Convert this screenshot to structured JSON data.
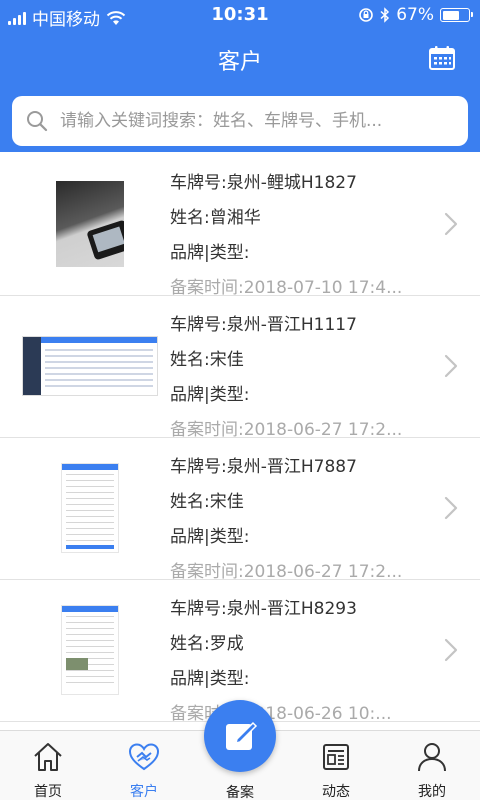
{
  "status_bar": {
    "carrier": "中国移动",
    "time": "10:31",
    "battery": "67%",
    "battery_level": 0.67,
    "icons": [
      "signal-icon",
      "wifi-icon",
      "orientation-lock-icon",
      "bluetooth-icon",
      "battery-icon"
    ]
  },
  "nav": {
    "title": "客户",
    "right_icon": "calendar-icon"
  },
  "search": {
    "placeholder": "请输入关键词搜索：姓名、车牌号、手机...",
    "value": ""
  },
  "customers": [
    {
      "plate": "车牌号:泉州-鲤城H1827",
      "name": "姓名:曾湘华",
      "brand_type": "品牌|类型:",
      "filed_time": "备案时间:2018-07-10 17:4...",
      "thumb": "photo"
    },
    {
      "plate": "车牌号:泉州-晋江H1117",
      "name": "姓名:宋佳",
      "brand_type": "品牌|类型:",
      "filed_time": "备案时间:2018-06-27 17:2...",
      "thumb": "screen"
    },
    {
      "plate": "车牌号:泉州-晋江H7887",
      "name": "姓名:宋佳",
      "brand_type": "品牌|类型:",
      "filed_time": "备案时间:2018-06-27 17:2...",
      "thumb": "doc"
    },
    {
      "plate": "车牌号:泉州-晋江H8293",
      "name": "姓名:罗成",
      "brand_type": "品牌|类型:",
      "filed_time": "备案时间:2018-06-26 10:...",
      "thumb": "doc-pic"
    }
  ],
  "tabbar": {
    "tabs": [
      {
        "label": "首页",
        "icon": "home-icon"
      },
      {
        "label": "客户",
        "icon": "heart-icon",
        "active": true
      },
      {
        "label": "动态",
        "icon": "news-icon"
      },
      {
        "label": "我的",
        "icon": "user-icon"
      }
    ],
    "center": {
      "label": "备案",
      "icon": "edit-icon"
    }
  },
  "colors": {
    "primary": "#3b7ff0",
    "text": "#333333",
    "muted": "#aaaaaa"
  }
}
